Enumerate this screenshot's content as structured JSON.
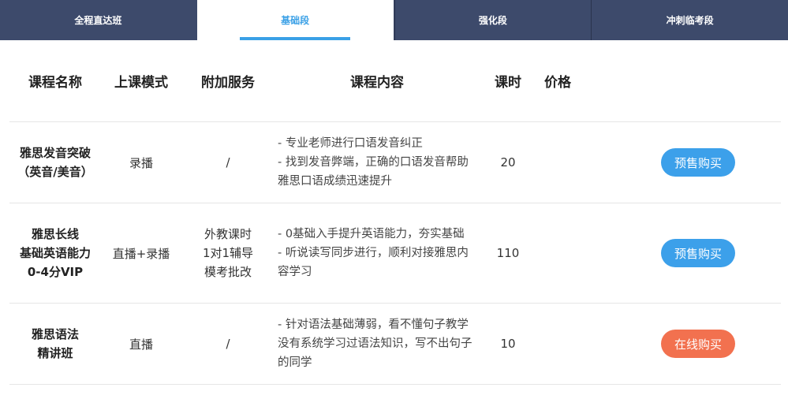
{
  "tabs": [
    {
      "label": "全程直达班",
      "active": false
    },
    {
      "label": "基础段",
      "active": true
    },
    {
      "label": "强化段",
      "active": false
    },
    {
      "label": "冲刺临考段",
      "active": false
    }
  ],
  "headers": {
    "name": "课程名称",
    "mode": "上课模式",
    "service": "附加服务",
    "content": "课程内容",
    "hours": "课时",
    "price": "价格"
  },
  "courses": [
    {
      "name": "雅思发音突破\n（英音/美音）",
      "mode": "录播",
      "service": "/",
      "content": [
        "- 专业老师进行口语发音纠正",
        "- 找到发音弊端，正确的口语发音帮助雅思口语成绩迅速提升"
      ],
      "hours": "20",
      "button": "预售购买",
      "button_color": "#3ca0ea"
    },
    {
      "name": "雅思长线\n基础英语能力\n0-4分VIP",
      "mode": "直播+录播",
      "service": "外教课时\n1对1辅导\n模考批改",
      "content": [
        "- 0基础入手提升英语能力，夯实基础",
        "- 听说读写同步进行，顺利对接雅思内容学习"
      ],
      "hours": "110",
      "button": "预售购买",
      "button_color": "#3ca0ea"
    },
    {
      "name": "雅思语法\n精讲班",
      "mode": "直播",
      "service": "/",
      "content": [
        "- 针对语法基础薄弱，看不懂句子教学没有系统学习过语法知识，写不出句子的同学"
      ],
      "hours": "10",
      "button": "在线购买",
      "button_color": "#f2714f"
    }
  ]
}
